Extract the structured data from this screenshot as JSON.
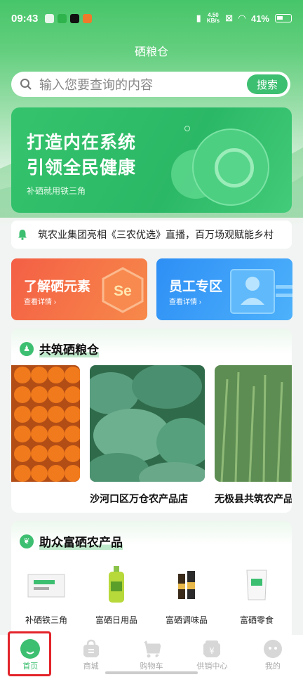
{
  "status_bar": {
    "time": "09:43",
    "speed_top": "4.50",
    "speed_bottom": "KB/s",
    "battery": "41%"
  },
  "header": {
    "title": "硒粮仓"
  },
  "search": {
    "placeholder": "输入您要查询的内容",
    "button": "搜索"
  },
  "banner": {
    "line1": "打造内在系统",
    "line2": "引领全民健康",
    "subtitle": "补硒就用铁三角"
  },
  "notice": {
    "text": "筑农业集团亮相《三农优选》直播，百万场观赋能乡村"
  },
  "cards": [
    {
      "title": "了解硒元素",
      "link": "查看详情 ›",
      "badge": "Se"
    },
    {
      "title": "员工专区",
      "link": "查看详情 ›"
    }
  ],
  "section_stores": {
    "title": "共筑硒粮仓",
    "stores": [
      {
        "name": ""
      },
      {
        "name": "沙河口区万仓农产品店"
      },
      {
        "name": "无极县共筑农产品"
      }
    ]
  },
  "section_products": {
    "title": "助众富硒农产品",
    "items": [
      {
        "name": "补硒铁三角"
      },
      {
        "name": "富硒日用品"
      },
      {
        "name": "富硒调味品"
      },
      {
        "name": "富硒零食"
      }
    ]
  },
  "tabbar": {
    "items": [
      {
        "label": "首页",
        "icon": "home-icon"
      },
      {
        "label": "商城",
        "icon": "shopping-bag-icon"
      },
      {
        "label": "购物车",
        "icon": "cart-icon"
      },
      {
        "label": "供销中心",
        "icon": "yen-icon"
      },
      {
        "label": "我的",
        "icon": "profile-icon"
      }
    ],
    "active_index": 0
  },
  "colors": {
    "brand_green": "#3dbf71",
    "orange_card": "#f45f45",
    "blue_card": "#2e8ff5",
    "highlight_outline": "#e2232a"
  }
}
